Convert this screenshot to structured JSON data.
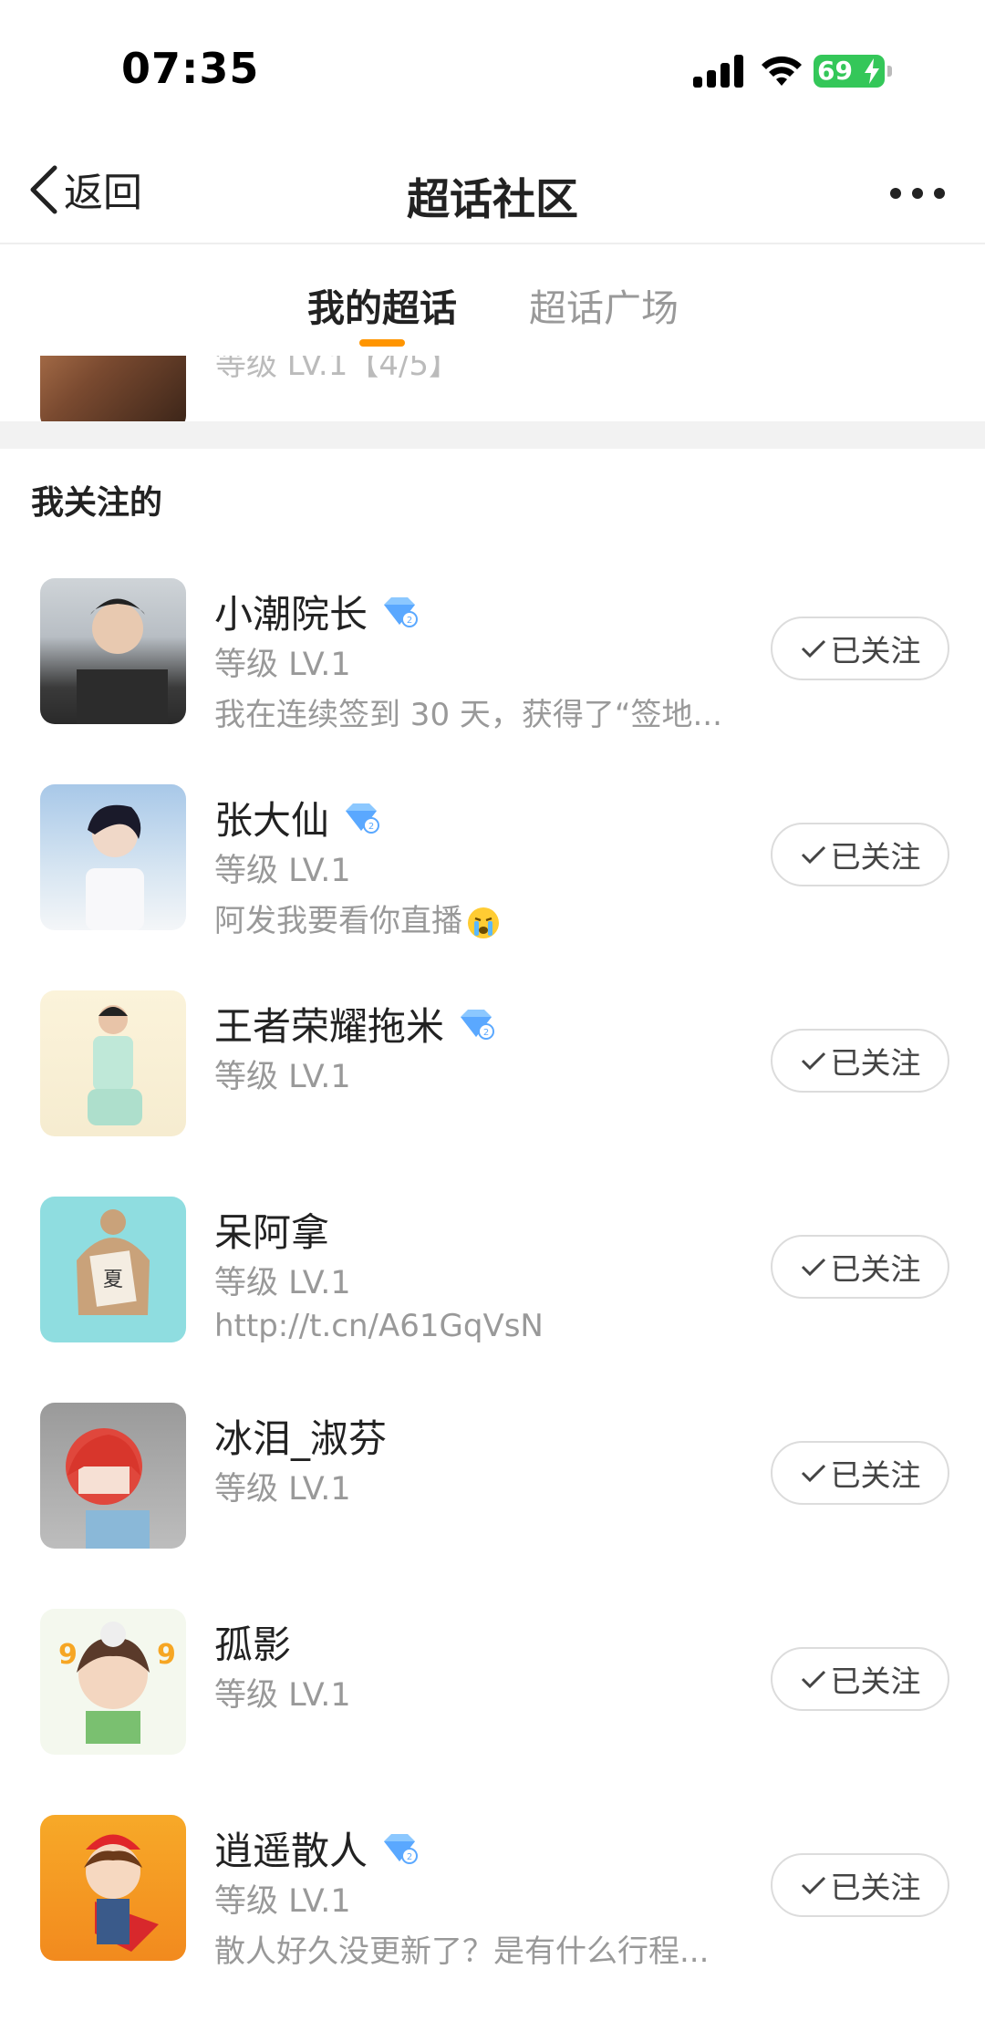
{
  "status_bar": {
    "time": "07:35",
    "battery": "69"
  },
  "nav": {
    "back_label": "返回",
    "title": "超话社区"
  },
  "tabs": [
    {
      "label": "我的超话",
      "active": true
    },
    {
      "label": "超话广场",
      "active": false
    }
  ],
  "partial_row": {
    "text": "等级 LV.1【4/5】"
  },
  "section_title": "我关注的",
  "follow_label": "已关注",
  "items": [
    {
      "name": "小潮院长",
      "verified": true,
      "level": "等级 LV.1",
      "desc": "我在连续签到 30 天，获得了“签地..."
    },
    {
      "name": "张大仙",
      "verified": true,
      "level": "等级 LV.1",
      "desc": "阿发我要看你直播",
      "emoji": "crying-emoji"
    },
    {
      "name": "王者荣耀拖米",
      "verified": true,
      "level": "等级 LV.1",
      "desc": ""
    },
    {
      "name": "呆阿拿",
      "verified": false,
      "level": "等级 LV.1",
      "desc": "http://t.cn/A61GqVsN"
    },
    {
      "name": "冰泪_淑芬",
      "verified": false,
      "level": "等级 LV.1",
      "desc": ""
    },
    {
      "name": "孤影",
      "verified": false,
      "level": "等级 LV.1",
      "desc": ""
    },
    {
      "name": "逍遥散人",
      "verified": true,
      "level": "等级 LV.1",
      "desc": "散人好久没更新了？是有什么行程..."
    }
  ],
  "colors": {
    "accent": "#ff9500",
    "battery": "#34c759",
    "verified": "#5aa8ff"
  }
}
